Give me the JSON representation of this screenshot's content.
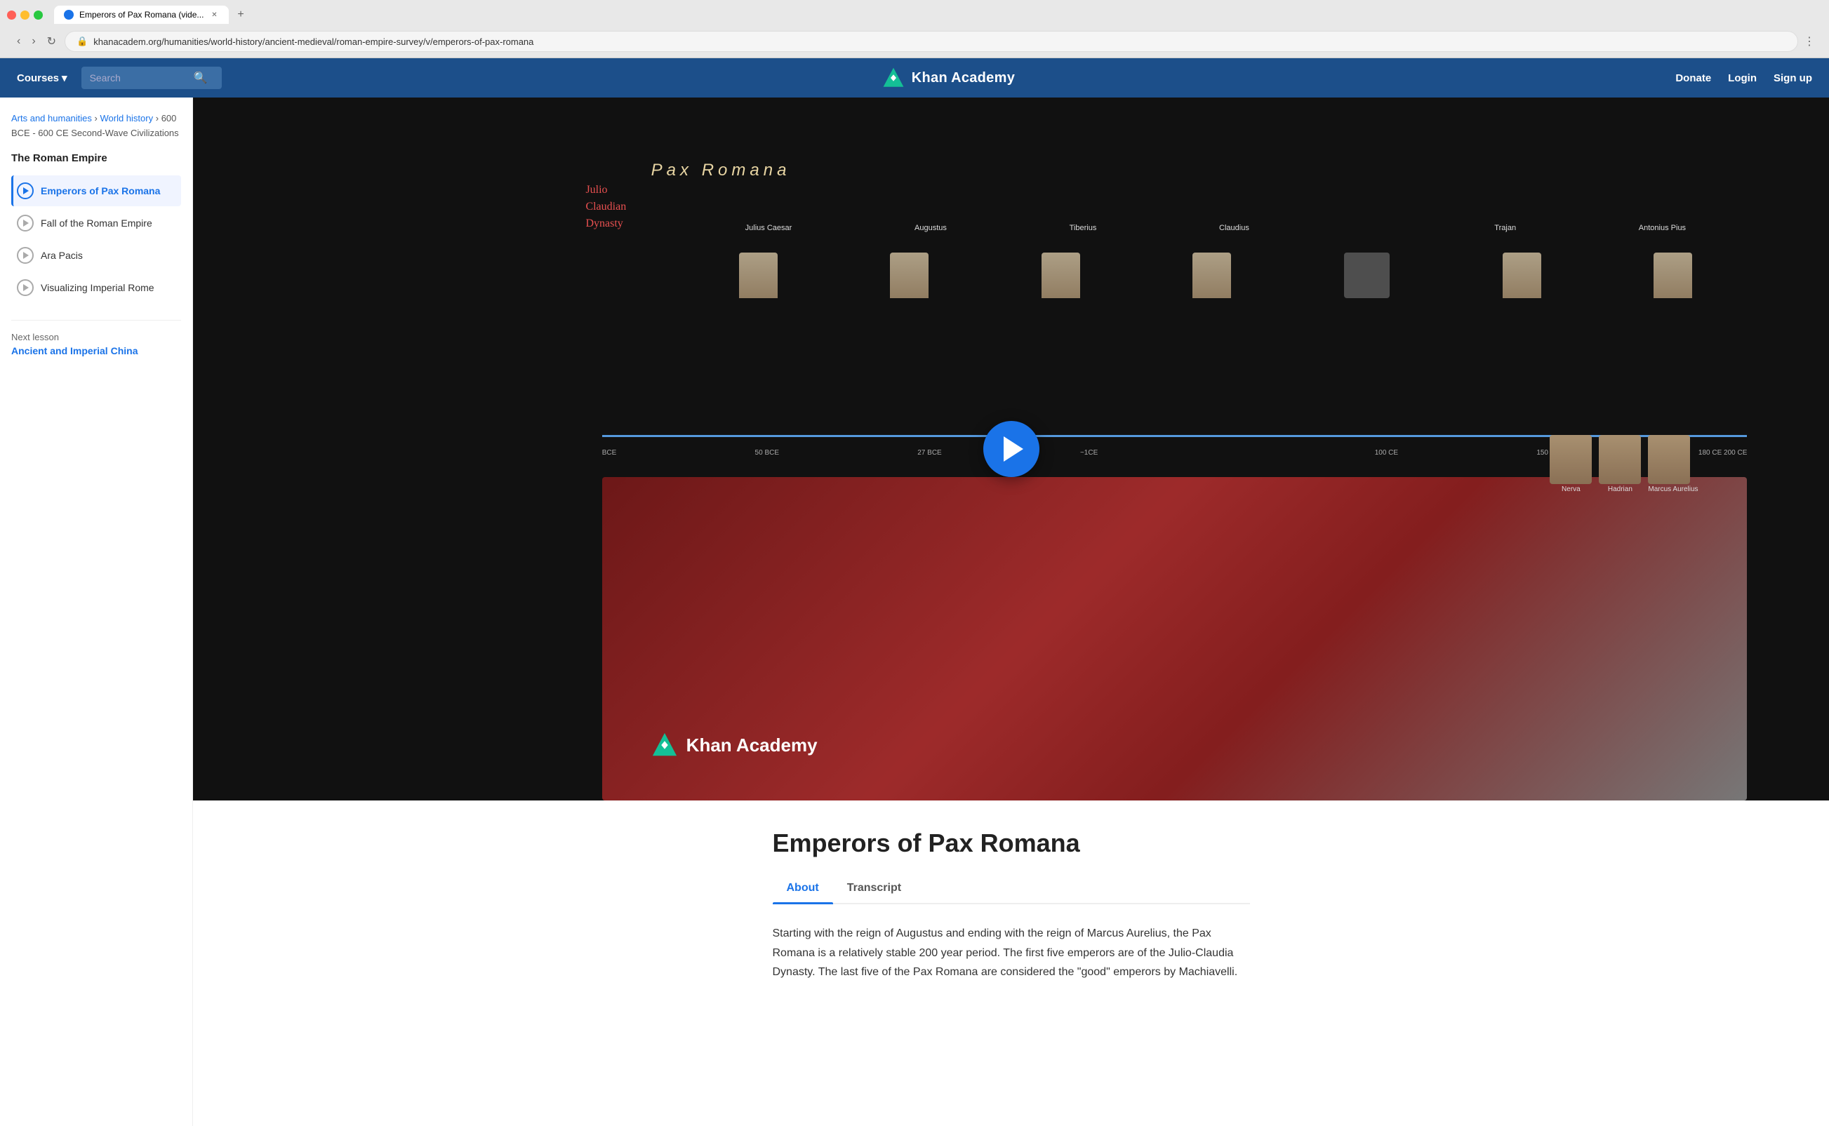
{
  "browser": {
    "tab_title": "Emperors of Pax Romana (vide...",
    "url": "khanacadem.org/humanities/world-history/ancient-medieval/roman-empire-survey/v/emperors-of-pax-romana",
    "new_tab_label": "+"
  },
  "navbar": {
    "courses_label": "Courses",
    "search_placeholder": "Search",
    "logo_text": "Khan Academy",
    "donate_label": "Donate",
    "login_label": "Login",
    "signup_label": "Sign up"
  },
  "sidebar": {
    "breadcrumb": {
      "part1": "Arts and humanities",
      "sep1": ">",
      "part2": "World history",
      "sep2": ">",
      "part3": "600 BCE - 600 CE Second-Wave Civilizations",
      "part4": "The Roman Empire"
    },
    "unit_title": "The Roman Empire",
    "lessons": [
      {
        "id": 1,
        "title": "Emperors of Pax Romana",
        "active": true
      },
      {
        "id": 2,
        "title": "Fall of the Roman Empire",
        "active": false
      },
      {
        "id": 3,
        "title": "Ara Pacis",
        "active": false
      },
      {
        "id": 4,
        "title": "Visualizing Imperial Rome",
        "active": false
      }
    ],
    "next_lesson_label": "Next lesson",
    "next_lesson_title": "Ancient and Imperial China"
  },
  "video": {
    "pax_romana_title": "Pax  Romana",
    "play_button_label": "Play video",
    "ka_logo_text": "Khan Academy"
  },
  "article": {
    "title": "Emperors of Pax Romana",
    "tabs": [
      {
        "id": "about",
        "label": "About",
        "active": true
      },
      {
        "id": "transcript",
        "label": "Transcript",
        "active": false
      }
    ],
    "body": "Starting with the reign of Augustus and ending with the reign of Marcus Aurelius, the Pax Romana is a relatively stable 200 year period. The first five emperors are of the Julio-Claudia Dynasty. The last five of the Pax Romana are considered the \"good\" emperors by Machiavelli."
  }
}
